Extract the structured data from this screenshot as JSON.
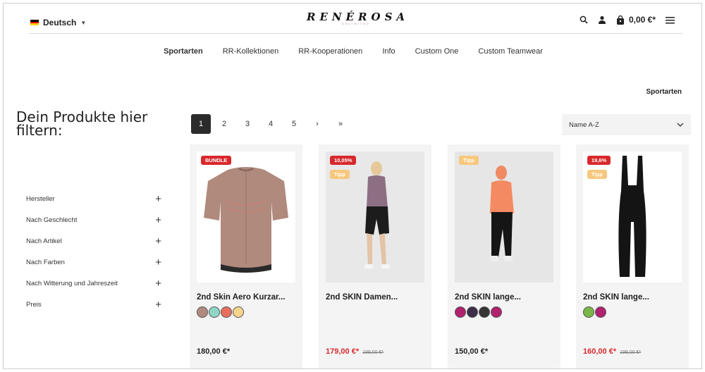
{
  "header": {
    "language": "Deutsch",
    "logo_text": "RENÉROSA",
    "logo_sub": "UNLIMITED",
    "cart_total": "0,00 €*"
  },
  "nav": [
    "Sportarten",
    "RR-Kollektionen",
    "RR-Kooperationen",
    "Info",
    "Custom One",
    "Custom Teamwear"
  ],
  "breadcrumb": "Sportarten",
  "sidebar": {
    "title": "Dein Produkte hier filtern:",
    "filters": [
      "Hersteller",
      "Nach Geschlecht",
      "Nach Artikel",
      "Nach Farben",
      "Nach Witterung und Jahreszeit",
      "Preis"
    ]
  },
  "pagination": {
    "pages": [
      "1",
      "2",
      "3",
      "4",
      "5"
    ],
    "next": "›",
    "last": "»",
    "current": "1"
  },
  "sort": {
    "selected": "Name A-Z"
  },
  "products": [
    {
      "name": "2nd Skin Aero Kurzar...",
      "badges": [
        "BUNDLE"
      ],
      "swatches": [
        "#b08a7d",
        "#8fd6c7",
        "#e96e5e",
        "#f6d48c"
      ],
      "price": "180,00 €*",
      "old_price": ""
    },
    {
      "name": "2nd SKIN Damen...",
      "badges": [
        "10,05%",
        "Tipp"
      ],
      "swatches": [],
      "price": "179,00 €*",
      "old_price": "199,00 €*"
    },
    {
      "name": "2nd SKIN lange...",
      "badges": [
        "Tipp"
      ],
      "swatches": [
        "#b0226e",
        "#3c2f4a",
        "#353535",
        "#b0226e"
      ],
      "price": "150,00 €*",
      "old_price": ""
    },
    {
      "name": "2nd SKIN lange...",
      "badges": [
        "19,6%",
        "Tipp"
      ],
      "swatches": [
        "#7ab648",
        "#b0226e"
      ],
      "price": "160,00 €*",
      "old_price": "199,00 €*"
    }
  ]
}
